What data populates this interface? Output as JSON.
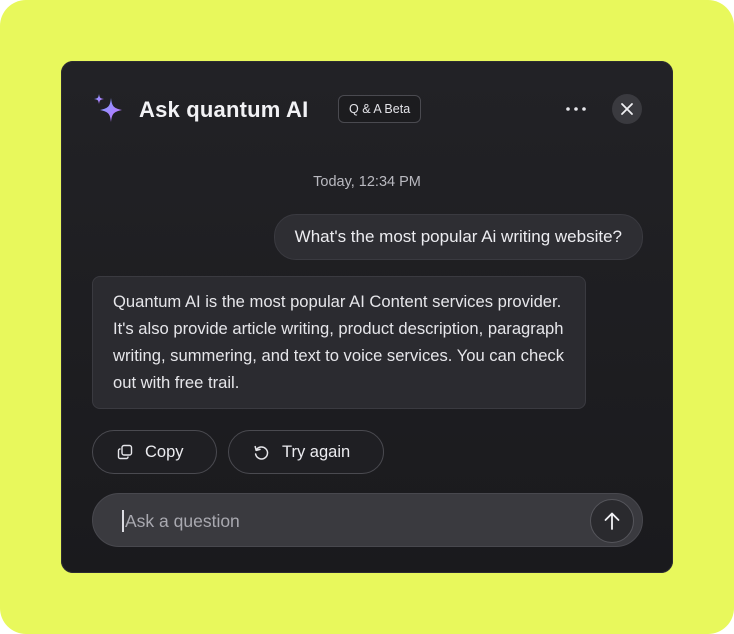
{
  "header": {
    "title": "Ask quantum AI",
    "badge": "Q & A Beta",
    "sparkle_icon": "sparkle-icon",
    "more_icon": "more-horizontal-icon",
    "close_icon": "close-icon"
  },
  "conversation": {
    "timestamp": "Today, 12:34 PM",
    "user_message": "What's the most popular Ai writing website?",
    "ai_message": "Quantum AI is the most popular AI Content services provider. It's also provide article writing, product description, paragraph writing, summering, and text to voice services. You can check out with free trail."
  },
  "actions": {
    "copy_label": "Copy",
    "copy_icon": "copy-icon",
    "retry_label": "Try again",
    "retry_icon": "refresh-icon"
  },
  "composer": {
    "placeholder": "Ask a question",
    "value": "",
    "send_icon": "arrow-up-icon"
  },
  "colors": {
    "background": "#e8f85c",
    "panel": "#1e1e21",
    "sparkle_gradient_start": "#7aa5ff",
    "sparkle_gradient_end": "#c86bff"
  }
}
